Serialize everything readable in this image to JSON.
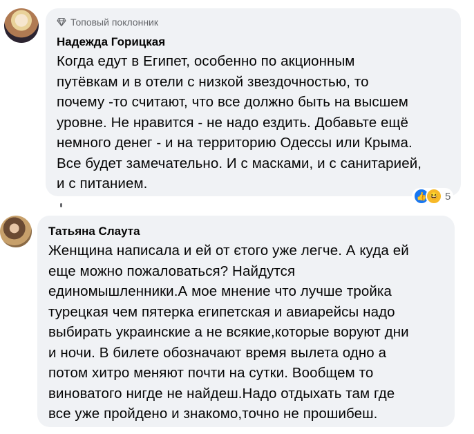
{
  "comment1": {
    "badge": "Топовый поклонник",
    "author": "Надежда Горицкая",
    "text": "Когда едут в Египет, особенно по акционным\nпутёвкам и в отели с низкой звездочностью, то\nпочему -то считают, что все должно быть на высшем\nуровне. Не нравится - не надо ездить. Добавьте ещё\nнемного денег - и на территорию Одессы или Крыма.\nВсе будет замечательно. И с масками, и с санитарией,\nи с питанием.",
    "reactions": {
      "icons": [
        "like-icon",
        "haha-icon"
      ],
      "count": "5"
    }
  },
  "comment2": {
    "author": "Татьяна Слаута",
    "text": "Женщина написала и ей от єтого уже легче. А куда ей\nеще можно пожаловаться?  Найдутся\nединомышленники.А мое мнение что лучше тройка\nтурецкая чем пятерка египетская и авиарейсы надо\nвыбирать украинские а не всякие,которые воруют дни\nи ночи. В билете обозначают время вылета одно а\nпотом хитро меняют почти на сутки. Вообщем то\nвиноватого нигде не найдеш.Надо отдыхать там где\nвсе уже пройдено и знакомо,точно не прошибеш."
  },
  "colors": {
    "bubble": "#f0f2f5",
    "meta": "#65676b",
    "like": "#1877f2",
    "haha": "#f7b928"
  }
}
